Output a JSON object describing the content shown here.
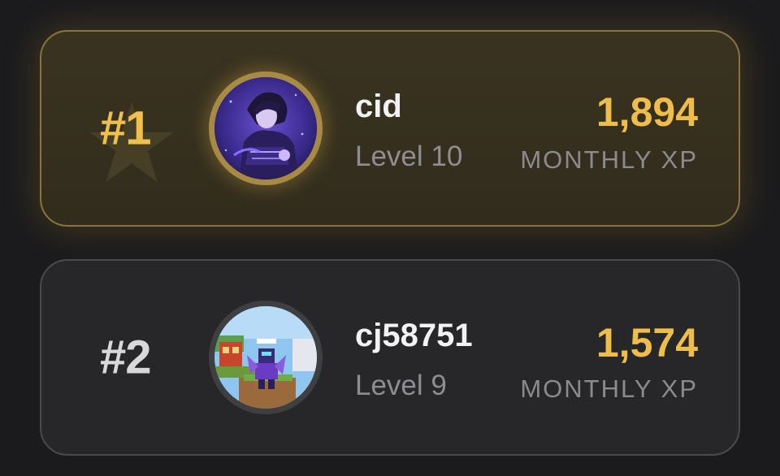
{
  "leaderboard": {
    "entries": [
      {
        "rank": "#1",
        "name": "cid",
        "level": "Level 10",
        "xp": "1,894",
        "xp_label": "MONTHLY XP",
        "avatar_icon": "purple-anime-character-avatar",
        "tier_color": "#f1c04c"
      },
      {
        "rank": "#2",
        "name": "cj58751",
        "level": "Level 9",
        "xp": "1,574",
        "xp_label": "MONTHLY XP",
        "avatar_icon": "blocky-game-character-avatar",
        "tier_color": "#d8d8da"
      }
    ],
    "colors": {
      "accent_gold": "#efbd4a",
      "background": "#1b1b1d"
    }
  }
}
